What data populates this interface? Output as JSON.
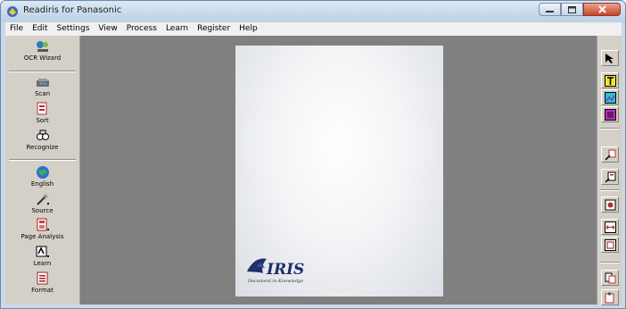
{
  "window": {
    "title": "Readiris for Panasonic"
  },
  "menu": [
    "File",
    "Edit",
    "Settings",
    "View",
    "Process",
    "Learn",
    "Register",
    "Help"
  ],
  "sidebar": {
    "items": [
      {
        "label": "OCR Wizard",
        "icon": "ocr-wizard-icon"
      },
      {
        "label": "Scan",
        "icon": "scanner-icon"
      },
      {
        "label": "Sort",
        "icon": "sort-pages-icon"
      },
      {
        "label": "Recognize",
        "icon": "recognize-glasses-icon"
      },
      {
        "label": "English",
        "icon": "globe-icon"
      },
      {
        "label": "Source",
        "icon": "source-wand-icon"
      },
      {
        "label": "Page Analysis",
        "icon": "page-analysis-icon"
      },
      {
        "label": "Learn",
        "icon": "learn-icon"
      },
      {
        "label": "Format",
        "icon": "format-icon"
      }
    ]
  },
  "document": {
    "logo_text": "IRIS",
    "logo_tagline": "Document to Knowledge"
  },
  "right_toolbar": {
    "tools": [
      "pointer-arrow-icon",
      "text-zone-icon",
      "image-zone-icon",
      "graphic-zone-icon",
      "link-zones-icon",
      "unlink-zones-icon",
      "zone-order-icon",
      "fit-width-icon",
      "fit-page-icon",
      "copy-zone-icon",
      "paste-zone-icon"
    ]
  },
  "colors": {
    "workspace": "#808080",
    "panel": "#d4d0c8",
    "titlebar": "#c9d9ea",
    "close_button": "#c8442a"
  }
}
